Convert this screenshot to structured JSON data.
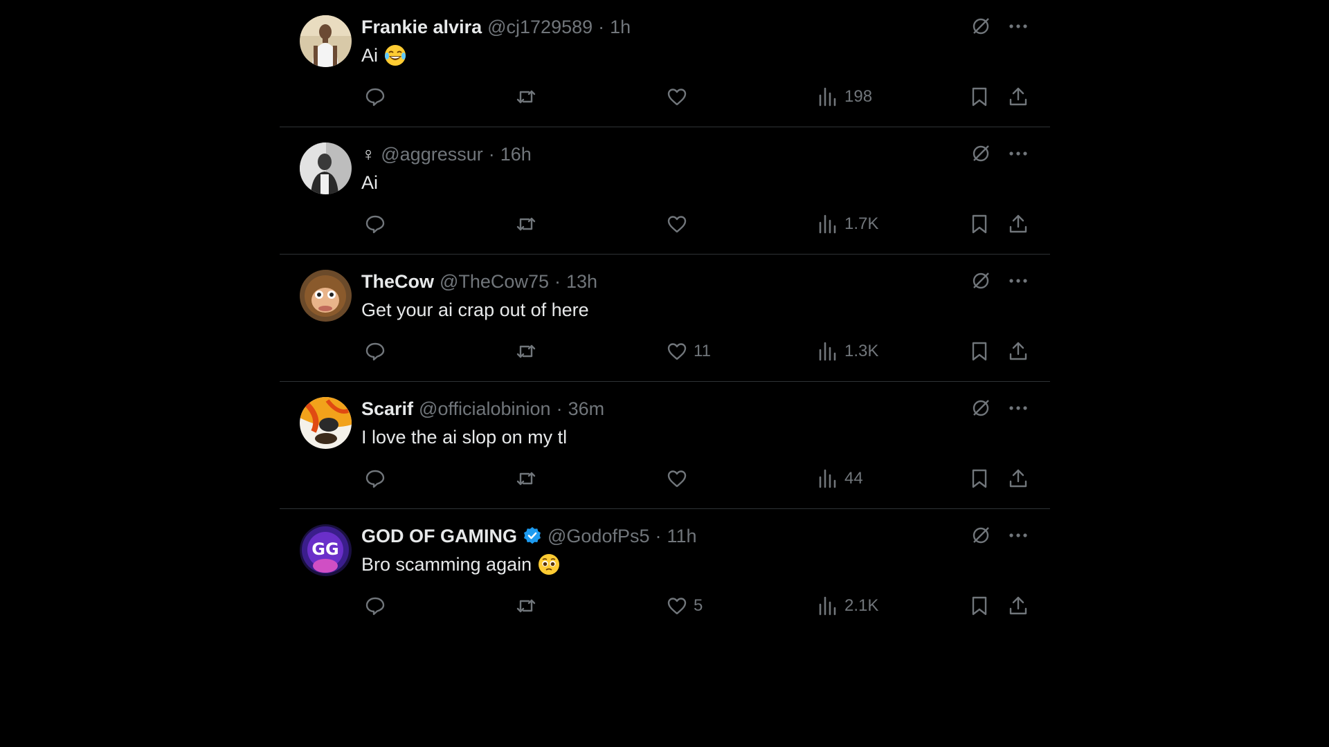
{
  "colors": {
    "background": "#000000",
    "text": "#e7e9ea",
    "muted": "#71767b",
    "divider": "#2f3336",
    "verified": "#1d9bf0"
  },
  "tweets": [
    {
      "name": "Frankie alvira",
      "handle": "@cj1729589",
      "separator": "·",
      "time": "1h",
      "text": "Ai",
      "emoji": "face-with-tears-of-joy",
      "verified": false,
      "likes": "",
      "views": "198"
    },
    {
      "name": "♀",
      "handle": "@aggressur",
      "separator": "·",
      "time": "16h",
      "text": "Ai",
      "emoji": "",
      "verified": false,
      "likes": "",
      "views": "1.7K"
    },
    {
      "name": "TheCow",
      "handle": "@TheCow75",
      "separator": "·",
      "time": "13h",
      "text": "Get your ai crap out of here",
      "emoji": "",
      "verified": false,
      "likes": "11",
      "views": "1.3K"
    },
    {
      "name": "Scarif",
      "handle": "@officialobinion",
      "separator": "·",
      "time": "36m",
      "text": "I love the ai slop on my tl",
      "emoji": "",
      "verified": false,
      "likes": "",
      "views": "44"
    },
    {
      "name": "GOD OF GAMING",
      "handle": "@GodofPs5",
      "separator": "·",
      "time": "11h",
      "text": "Bro scamming again",
      "emoji": "pleading-face",
      "verified": true,
      "likes": "5",
      "views": "2.1K"
    }
  ]
}
